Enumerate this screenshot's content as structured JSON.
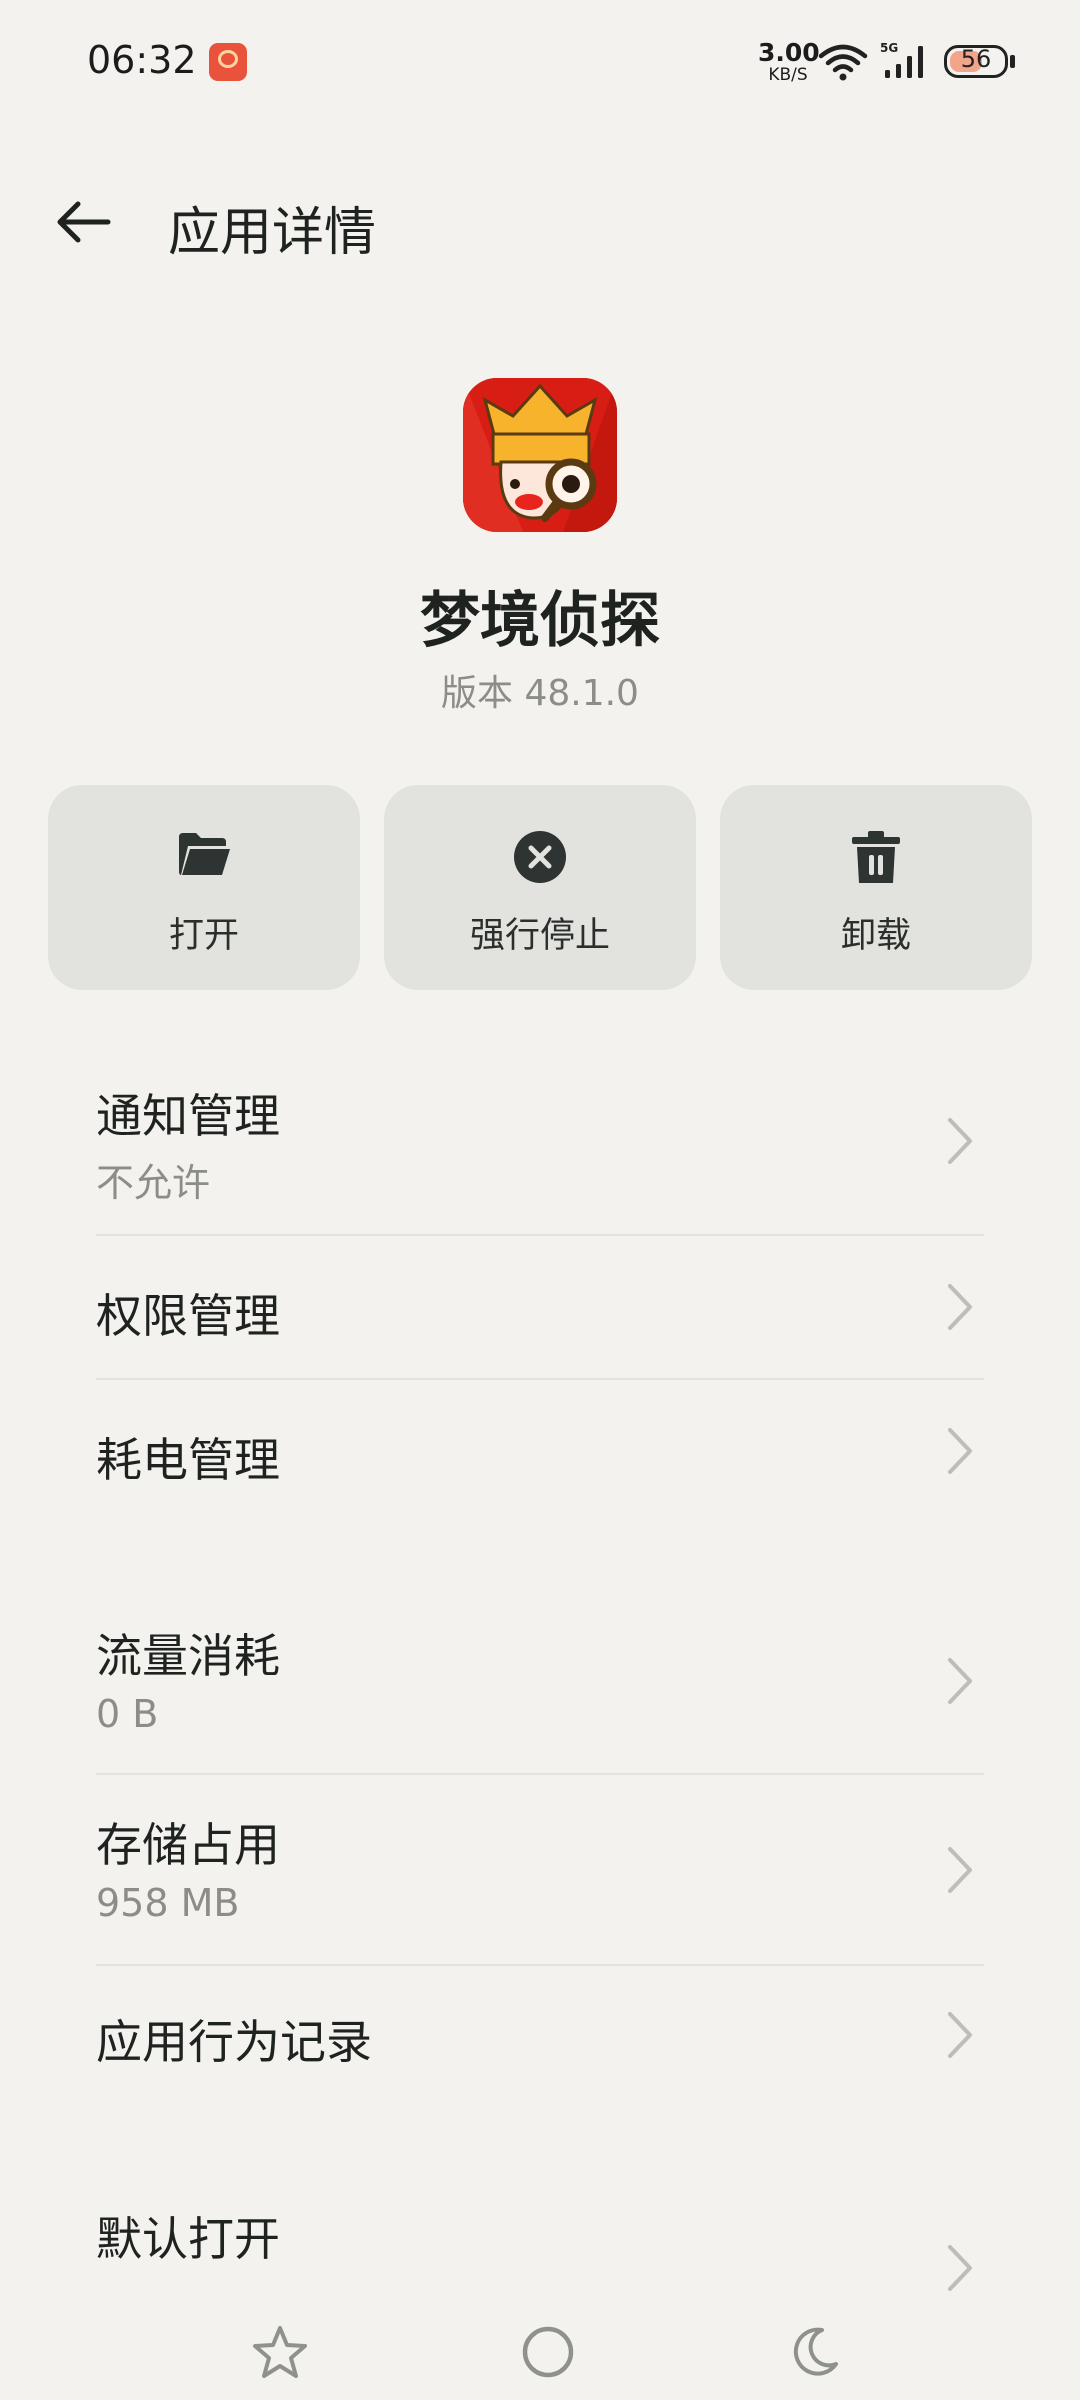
{
  "status_bar": {
    "time": "06:32",
    "net_speed_value": "3.00",
    "net_speed_unit": "KB/S",
    "network_type": "5G",
    "battery_level": "56",
    "icons": [
      "notification-app-icon",
      "wifi-icon",
      "signal-icon",
      "battery-icon"
    ]
  },
  "header": {
    "title": "应用详情",
    "back_icon": "back-arrow-icon"
  },
  "app": {
    "name": "梦境侦探",
    "version": "版本 48.1.0",
    "icon": "app-icon-detective"
  },
  "actions": [
    {
      "label": "打开",
      "icon": "folder-open-icon"
    },
    {
      "label": "强行停止",
      "icon": "force-stop-icon"
    },
    {
      "label": "卸载",
      "icon": "trash-icon"
    }
  ],
  "group1": [
    {
      "title": "通知管理",
      "subtitle": "不允许"
    },
    {
      "title": "权限管理"
    },
    {
      "title": "耗电管理"
    }
  ],
  "group2": [
    {
      "title": "流量消耗",
      "subtitle": "0 B"
    },
    {
      "title": "存储占用",
      "subtitle": "958 MB"
    },
    {
      "title": "应用行为记录"
    }
  ],
  "group3": [
    {
      "title": "默认打开"
    }
  ],
  "nav_bar": [
    "star-icon",
    "home-circle-icon",
    "moon-icon"
  ],
  "colors": {
    "background": "#f3f2ef",
    "button_bg": "#e2e2de",
    "text_primary": "#1f2320",
    "text_secondary": "#8c8c88",
    "app_icon_red": "#d81e14"
  }
}
